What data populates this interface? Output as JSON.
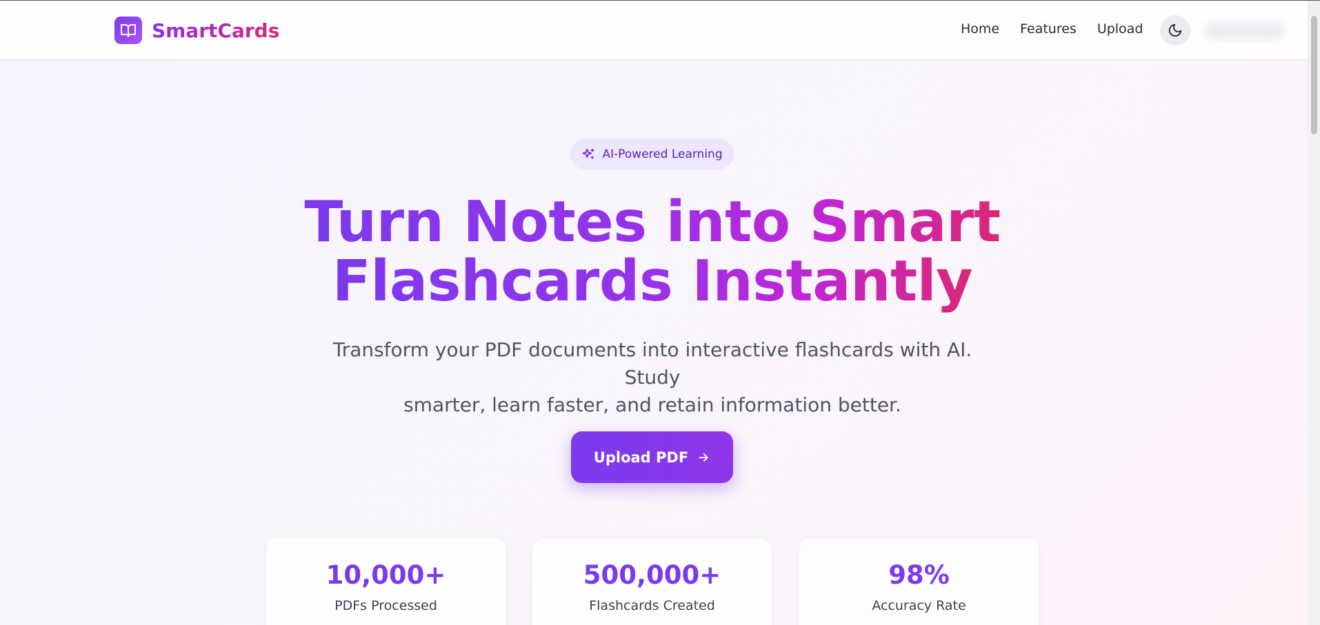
{
  "brand": {
    "name": "SmartCards",
    "logo_icon": "book-open-icon"
  },
  "nav": {
    "items": [
      "Home",
      "Features",
      "Upload"
    ],
    "theme_icon": "moon-icon"
  },
  "hero": {
    "badge": "AI-Powered Learning",
    "badge_icon": "sparkles-icon",
    "title_line1": "Turn Notes into Smart",
    "title_line2": "Flashcards Instantly",
    "subtitle_line1": "Transform your PDF documents into interactive flashcards with AI. Study",
    "subtitle_line2": "smarter, learn faster, and retain information better.",
    "cta": "Upload PDF",
    "cta_icon": "arrow-right-icon"
  },
  "stats": [
    {
      "value": "10,000+",
      "label": "PDFs Processed"
    },
    {
      "value": "500,000+",
      "label": "Flashcards Created"
    },
    {
      "value": "98%",
      "label": "Accuracy Rate"
    }
  ],
  "colors": {
    "accent": "#7c3aed",
    "pink": "#db2777"
  }
}
